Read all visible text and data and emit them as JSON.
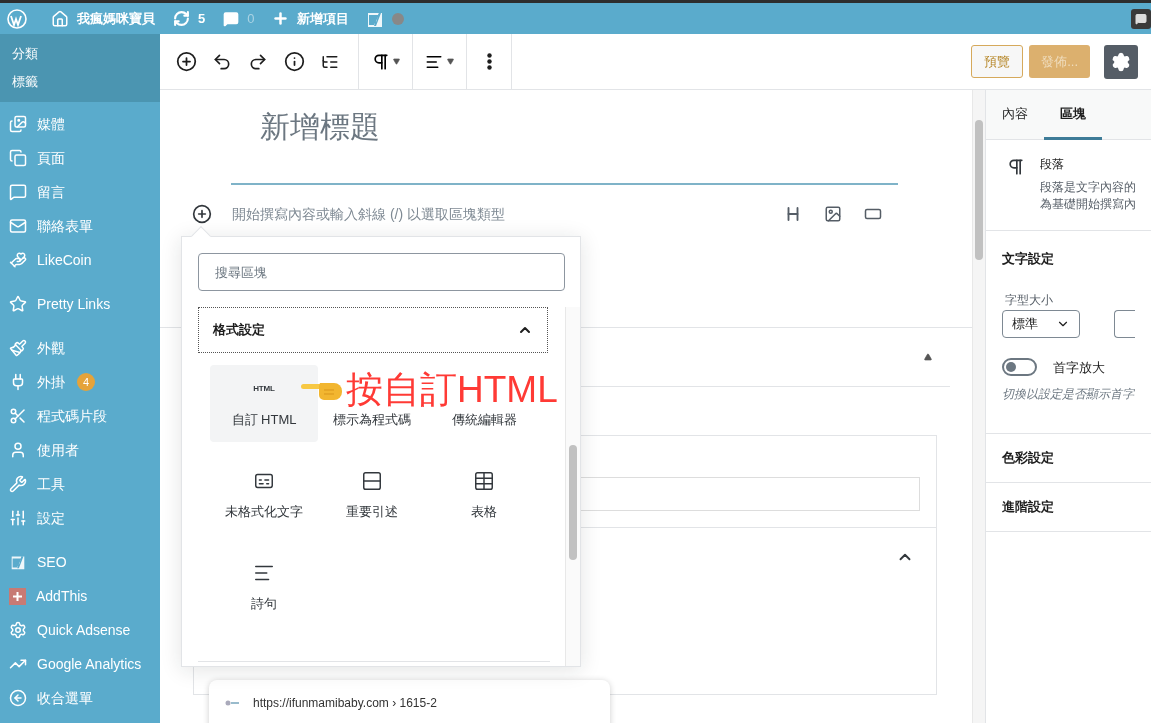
{
  "admin_bar": {
    "site_name": "我瘋媽咪寶貝",
    "updates": "5",
    "comments": "0",
    "new_item": "新增項目"
  },
  "sidebar": {
    "submenu": [
      {
        "label": "分類"
      },
      {
        "label": "標籤"
      }
    ],
    "menu_groups": [
      [
        {
          "label": "媒體"
        },
        {
          "label": "頁面"
        },
        {
          "label": "留言"
        },
        {
          "label": "聯絡表單"
        },
        {
          "label": "LikeCoin"
        }
      ],
      [
        {
          "label": "Pretty Links"
        }
      ],
      [
        {
          "label": "外觀"
        },
        {
          "label": "外掛",
          "badge": "4"
        },
        {
          "label": "程式碼片段"
        },
        {
          "label": "使用者"
        },
        {
          "label": "工具"
        },
        {
          "label": "設定"
        }
      ],
      [
        {
          "label": "SEO"
        },
        {
          "label": "AddThis"
        },
        {
          "label": "Quick Adsense"
        },
        {
          "label": "Google Analytics"
        },
        {
          "label": "收合選單"
        }
      ]
    ]
  },
  "toolbar": {
    "preview": "預覽",
    "publish": "發佈...",
    "settings_selected": true
  },
  "editor": {
    "title_placeholder": "新增標題",
    "block_placeholder": "開始撰寫內容或輸入斜線 (/) 以選取區塊類型"
  },
  "inserter": {
    "search_placeholder": "搜尋區塊",
    "category": {
      "label": "格式設定",
      "expanded": true
    },
    "blocks": [
      {
        "label": "自訂 HTML",
        "icon_text": "HTML",
        "selected": true
      },
      {
        "label": "標示為程式碼",
        "selected": false
      },
      {
        "label": "傳統編輯器",
        "selected": false
      },
      {
        "label": "未格式化文字",
        "selected": false
      },
      {
        "label": "重要引述",
        "selected": false
      },
      {
        "label": "表格",
        "selected": false
      },
      {
        "label": "詩句",
        "selected": false
      }
    ]
  },
  "annotation": {
    "text": "按自訂HTML"
  },
  "link_preview": {
    "url": "https://ifunmamibaby.com › 1615-2"
  },
  "settings_panel": {
    "tabs": [
      {
        "label": "內容",
        "selected": false
      },
      {
        "label": "區塊",
        "selected": true
      }
    ],
    "block": {
      "name": "段落",
      "description": [
        "段落是文字內容的",
        "為基礎開始撰寫內"
      ]
    },
    "typography": {
      "title": "文字設定",
      "font_size_label": "字型大小",
      "font_size_value": "標準",
      "drop_cap": {
        "label": "首字放大",
        "on": false,
        "help": "切換以設定是否顯示首字"
      }
    },
    "sections": [
      {
        "title": "色彩設定"
      },
      {
        "title": "進階設定"
      }
    ]
  }
}
